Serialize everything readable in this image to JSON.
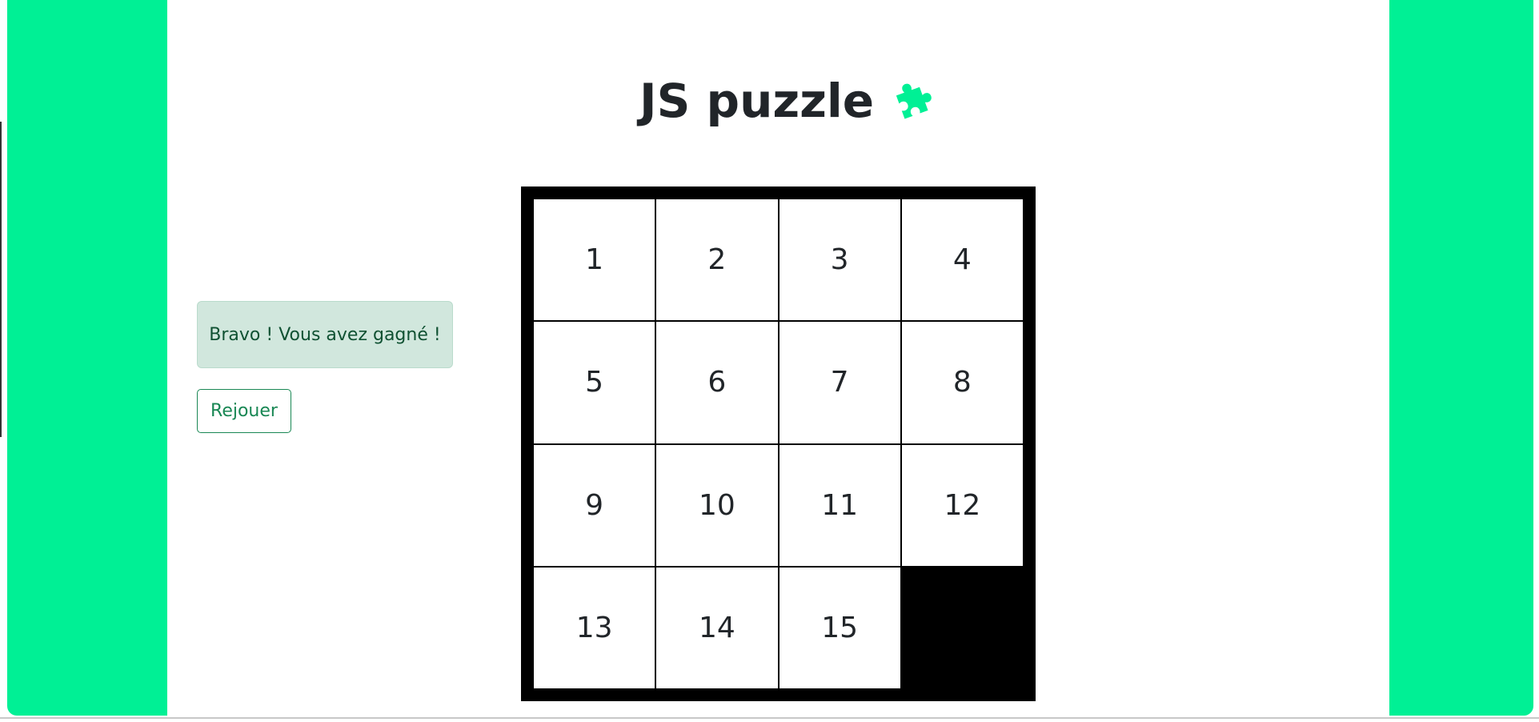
{
  "header": {
    "title": "JS puzzle",
    "icon": "puzzle-piece-icon",
    "icon_color": "#00f095"
  },
  "status": {
    "message": "Bravo ! Vous avez gagné !"
  },
  "controls": {
    "replay_label": "Rejouer"
  },
  "board": {
    "tiles": [
      "1",
      "2",
      "3",
      "4",
      "5",
      "6",
      "7",
      "8",
      "9",
      "10",
      "11",
      "12",
      "13",
      "14",
      "15",
      ""
    ]
  },
  "colors": {
    "accent": "#00f095",
    "success_bg": "#d1e7dd",
    "success_text": "#0f5132",
    "outline_green": "#198754"
  }
}
